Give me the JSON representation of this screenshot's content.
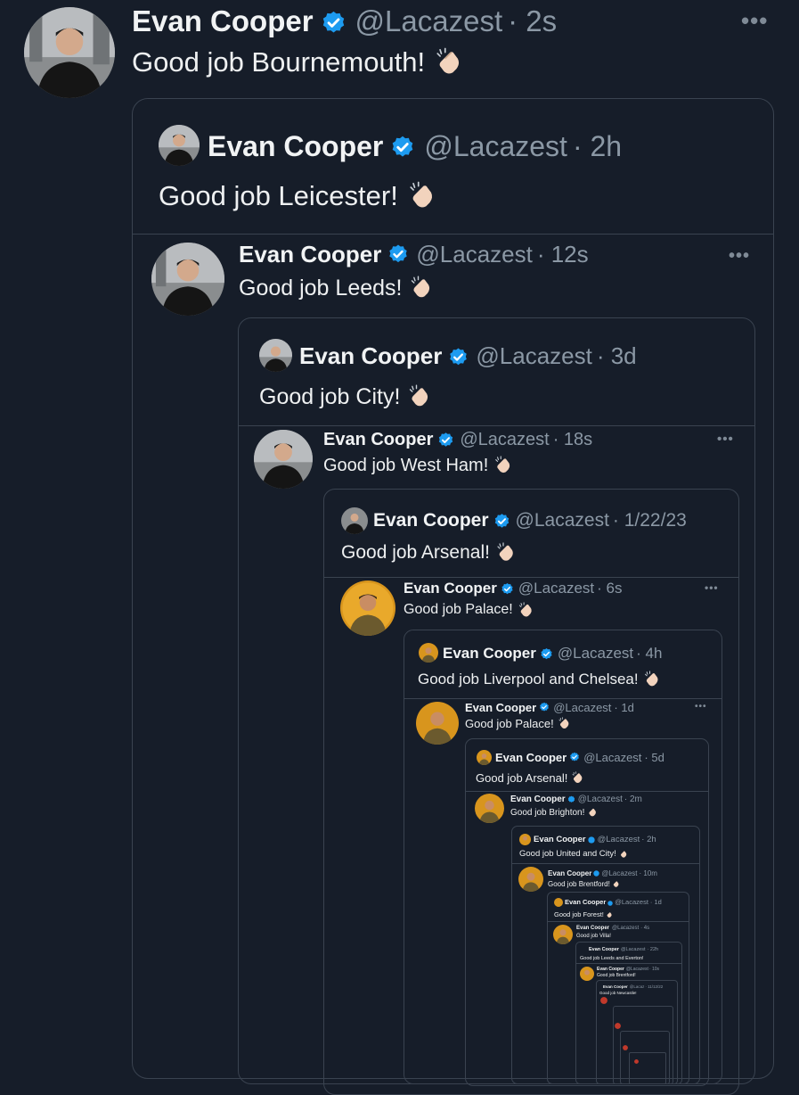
{
  "colors": {
    "background": "#161d29",
    "verified": "#1d9bf0",
    "border": "#3a4350",
    "handle": "#8b98a5"
  },
  "icons": {
    "verified": "verified-badge-icon",
    "clap": "clapping-hands-emoji",
    "more": "more-options-icon"
  },
  "tweets": [
    {
      "name": "Evan Cooper",
      "handle": "@Lacazest",
      "time": "· 2s",
      "text": "Good job Bournemouth!"
    },
    {
      "name": "Evan Cooper",
      "handle": "@Lacazest",
      "time": "· 2h",
      "text": "Good job Leicester!"
    },
    {
      "name": "Evan Cooper",
      "handle": "@Lacazest",
      "time": "· 12s",
      "text": "Good job Leeds!"
    },
    {
      "name": "Evan Cooper",
      "handle": "@Lacazest",
      "time": "· 3d",
      "text": "Good job City!"
    },
    {
      "name": "Evan Cooper",
      "handle": "@Lacazest",
      "time": "· 18s",
      "text": "Good job West Ham!"
    },
    {
      "name": "Evan Cooper",
      "handle": "@Lacazest",
      "time": "· 1/22/23",
      "text": "Good job Arsenal!"
    },
    {
      "name": "Evan Cooper",
      "handle": "@Lacazest",
      "time": "· 6s",
      "text": "Good job Palace!"
    },
    {
      "name": "Evan Cooper",
      "handle": "@Lacazest",
      "time": "· 4h",
      "text": "Good job Liverpool and Chelsea!"
    },
    {
      "name": "Evan Cooper",
      "handle": "@Lacazest",
      "time": "· 1d",
      "text": "Good job Palace!"
    },
    {
      "name": "Evan Cooper",
      "handle": "@Lacazest",
      "time": "· 5d",
      "text": "Good job Arsenal!"
    },
    {
      "name": "Evan Cooper",
      "handle": "@Lacazest",
      "time": "· 2m",
      "text": "Good job Brighton!"
    },
    {
      "name": "Evan Cooper",
      "handle": "@Lacazest",
      "time": "· 2h",
      "text": "Good job United and City!"
    },
    {
      "name": "Evan Cooper",
      "handle": "@Lacazest",
      "time": "· 10m",
      "text": "Good job Brentford!"
    },
    {
      "name": "Evan Cooper",
      "handle": "@Lacazest",
      "time": "· 1d",
      "text": "Good job Forest!"
    },
    {
      "name": "Evan Cooper",
      "handle": "@Lacazest",
      "time": "· 4s",
      "text": "Good job Villa!"
    },
    {
      "name": "Evan Cooper",
      "handle": "@Lacazest",
      "time": "· 22h",
      "text": "Good job Leeds and Everton!"
    },
    {
      "name": "Evan Cooper",
      "handle": "@Lacazest",
      "time": "· 10s",
      "text": "Good job Brentford!"
    },
    {
      "name": "Evan Cooper",
      "handle": "@Lacaz",
      "time": "· 11/12/22",
      "text": "Good job Newcastle!"
    }
  ]
}
